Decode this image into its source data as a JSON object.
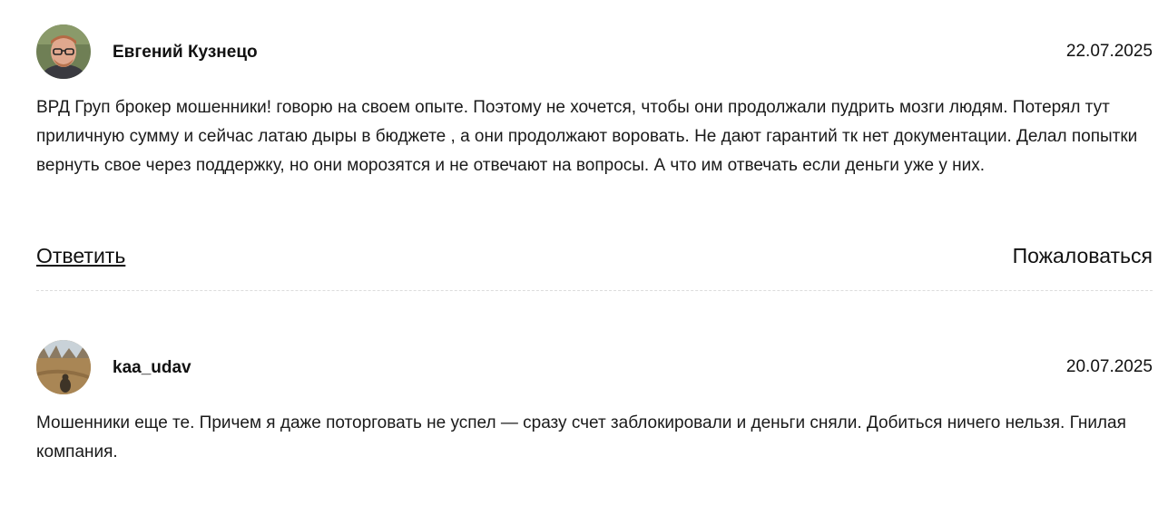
{
  "comments": [
    {
      "author": "Евгений Кузнецо",
      "date": "22.07.2025",
      "text": "ВРД Груп брокер мошенники! говорю на своем опыте. Поэтому не хочется, чтобы они продолжали пудрить мозги людям. Потерял тут приличную сумму и сейчас латаю дыры в бюджете , а они продолжают воровать. Не дают гарантий тк нет документации. Делал попытки вернуть свое через поддержку, но они морозятся и не отвечают на вопросы. А что им отвечать если деньги уже у них.",
      "reply_label": "Ответить",
      "report_label": "Пожаловаться"
    },
    {
      "author": "kaa_udav",
      "date": "20.07.2025",
      "text": "Мошенники еще те. Причем я даже поторговать не успел — сразу счет заблокировали и деньги сняли. Добиться ничего нельзя. Гнилая компания."
    }
  ]
}
